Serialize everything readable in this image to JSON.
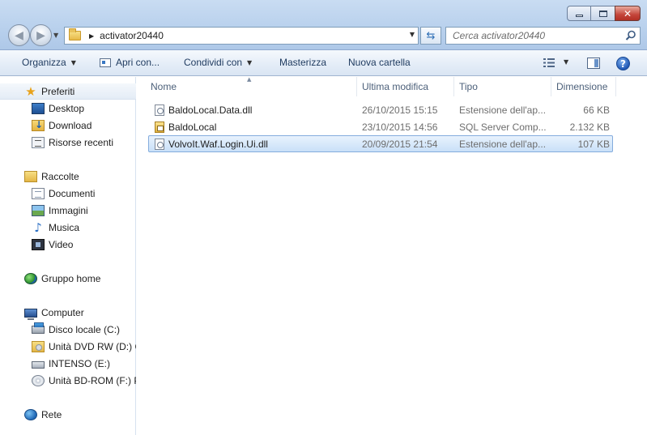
{
  "address": {
    "path_segment": "activator20440"
  },
  "search": {
    "placeholder": "Cerca activator20440"
  },
  "toolbar": {
    "organize": "Organizza",
    "open_with": "Apri con...",
    "share_with": "Condividi con",
    "burn": "Masterizza",
    "new_folder": "Nuova cartella"
  },
  "navigation": {
    "favorites": {
      "label": "Preferiti",
      "items": [
        {
          "label": "Desktop"
        },
        {
          "label": "Download"
        },
        {
          "label": "Risorse recenti"
        }
      ]
    },
    "libraries": {
      "label": "Raccolte",
      "items": [
        {
          "label": "Documenti"
        },
        {
          "label": "Immagini"
        },
        {
          "label": "Musica"
        },
        {
          "label": "Video"
        }
      ]
    },
    "homegroup": {
      "label": "Gruppo home"
    },
    "computer": {
      "label": "Computer",
      "items": [
        {
          "label": "Disco locale (C:)"
        },
        {
          "label": "Unità DVD RW (D:) C"
        },
        {
          "label": "INTENSO (E:)"
        },
        {
          "label": "Unità BD-ROM (F:) P"
        }
      ]
    },
    "network": {
      "label": "Rete"
    }
  },
  "columns": {
    "name": "Nome",
    "modified": "Ultima modifica",
    "type": "Tipo",
    "size": "Dimensione"
  },
  "files": [
    {
      "name": "BaldoLocal.Data.dll",
      "modified": "26/10/2015 15:15",
      "type": "Estensione dell'ap...",
      "size": "66 KB",
      "icon": "dll-file-icon"
    },
    {
      "name": "BaldoLocal",
      "modified": "23/10/2015 14:56",
      "type": "SQL Server Comp...",
      "size": "2.132 KB",
      "icon": "sql-file-icon"
    },
    {
      "name": "VolvoIt.Waf.Login.Ui.dll",
      "modified": "20/09/2015 21:54",
      "type": "Estensione dell'ap...",
      "size": "107 KB",
      "icon": "dll-file-icon",
      "selected": true
    }
  ]
}
